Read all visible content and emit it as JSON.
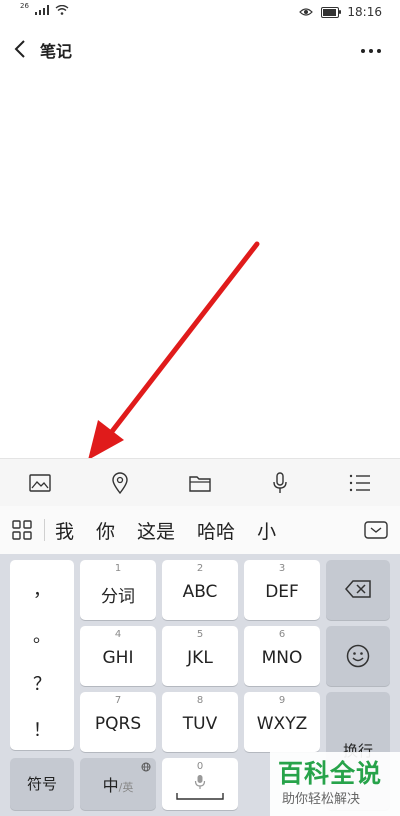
{
  "status_bar": {
    "network": "26",
    "time": "18:16"
  },
  "header": {
    "title": "笔记"
  },
  "toolbar": {
    "icons": [
      "image-icon",
      "location-icon",
      "folder-icon",
      "microphone-icon",
      "list-icon"
    ]
  },
  "candidates": {
    "words": [
      "我",
      "你",
      "这是",
      "哈哈",
      "小"
    ]
  },
  "keyboard": {
    "punctuation": [
      "，",
      "。",
      "？",
      "！"
    ],
    "keys": [
      {
        "num": "1",
        "label": "分词"
      },
      {
        "num": "2",
        "label": "ABC"
      },
      {
        "num": "3",
        "label": "DEF"
      },
      {
        "num": "4",
        "label": "GHI"
      },
      {
        "num": "5",
        "label": "JKL"
      },
      {
        "num": "6",
        "label": "MNO"
      },
      {
        "num": "7",
        "label": "PQRS"
      },
      {
        "num": "8",
        "label": "TUV"
      },
      {
        "num": "9",
        "label": "WXYZ"
      }
    ],
    "symbol_label": "符号",
    "lang_main": "中",
    "lang_sub": "/英",
    "space_num": "0",
    "enter_label": "换行"
  },
  "watermark": {
    "title": "百科全说",
    "subtitle": "助你轻松解决"
  },
  "colors": {
    "accent_red": "#e01b1b",
    "watermark_green": "#27a34a"
  }
}
